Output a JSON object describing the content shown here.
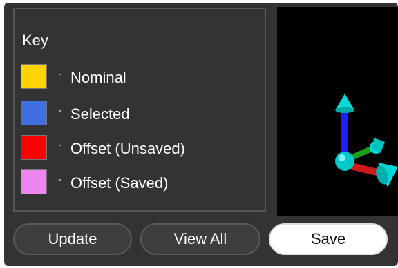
{
  "key": {
    "title": "Key",
    "items": [
      {
        "label": "Nominal",
        "color": "#FFD400"
      },
      {
        "label": "Selected",
        "color": "#3F6FE0"
      },
      {
        "label": "Offset (Unsaved)",
        "color": "#FF0000"
      },
      {
        "label": "Offset (Saved)",
        "color": "#EE82EE"
      }
    ],
    "separator": "-"
  },
  "viewport": {
    "background": "#000000",
    "gizmo_axes": [
      {
        "name": "up-axis",
        "color": "#1E1EFF",
        "tip_color": "#00E0E0"
      },
      {
        "name": "forward-axis",
        "color": "#1AA01A",
        "tip_color": "#00E0E0"
      },
      {
        "name": "right-axis",
        "color": "#D01818",
        "tip_color": "#00E0E0"
      }
    ]
  },
  "buttons": {
    "update": "Update",
    "view_all": "View All",
    "save": "Save"
  }
}
